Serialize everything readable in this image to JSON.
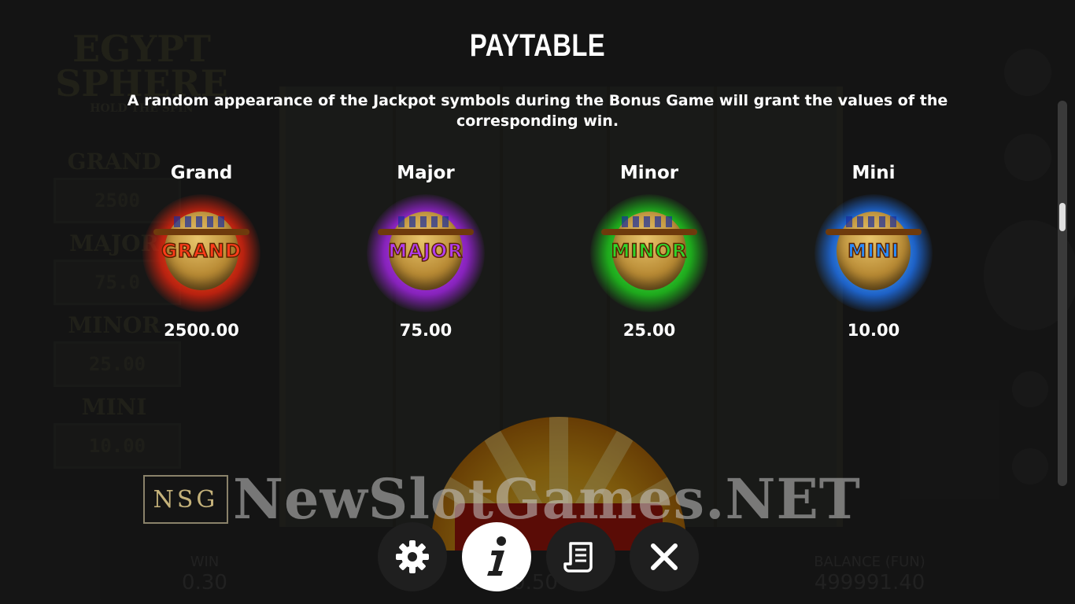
{
  "paytable": {
    "title": "PAYTABLE",
    "description": "A random appearance of the Jackpot symbols during the Bonus Game will grant the values of the corresponding win.",
    "jackpots": [
      {
        "name": "Grand",
        "symbol_label": "GRAND",
        "value": "2500.00",
        "color": "#e1250f"
      },
      {
        "name": "Major",
        "symbol_label": "MAJOR",
        "value": "75.00",
        "color": "#9a24d8"
      },
      {
        "name": "Minor",
        "symbol_label": "MINOR",
        "value": "25.00",
        "color": "#1fc21d"
      },
      {
        "name": "Mini",
        "symbol_label": "MINI",
        "value": "10.00",
        "color": "#1f6fe6"
      }
    ]
  },
  "background": {
    "logo_line1": "EGYPT",
    "logo_line2": "SPHERE",
    "logo_tagline": "HOLD THE SPIN",
    "jackpot_panel": [
      {
        "label": "GRAND",
        "value": "2500"
      },
      {
        "label": "MAJOR",
        "value": "75.0"
      },
      {
        "label": "MINOR",
        "value": "25.00"
      },
      {
        "label": "MINI",
        "value": "10.00"
      }
    ],
    "win_label": "WIN",
    "win_value": "0.30",
    "bet_value": "0.50",
    "balance_label": "BALANCE (FUN)",
    "balance_value": "499991.40"
  },
  "watermark": {
    "box_text": "NSG",
    "text": "NewSlotGames.NET"
  },
  "toolbar": {
    "settings_icon": "gear-icon",
    "info_icon": "info-icon",
    "rules_icon": "scroll-icon",
    "close_icon": "close-icon"
  }
}
